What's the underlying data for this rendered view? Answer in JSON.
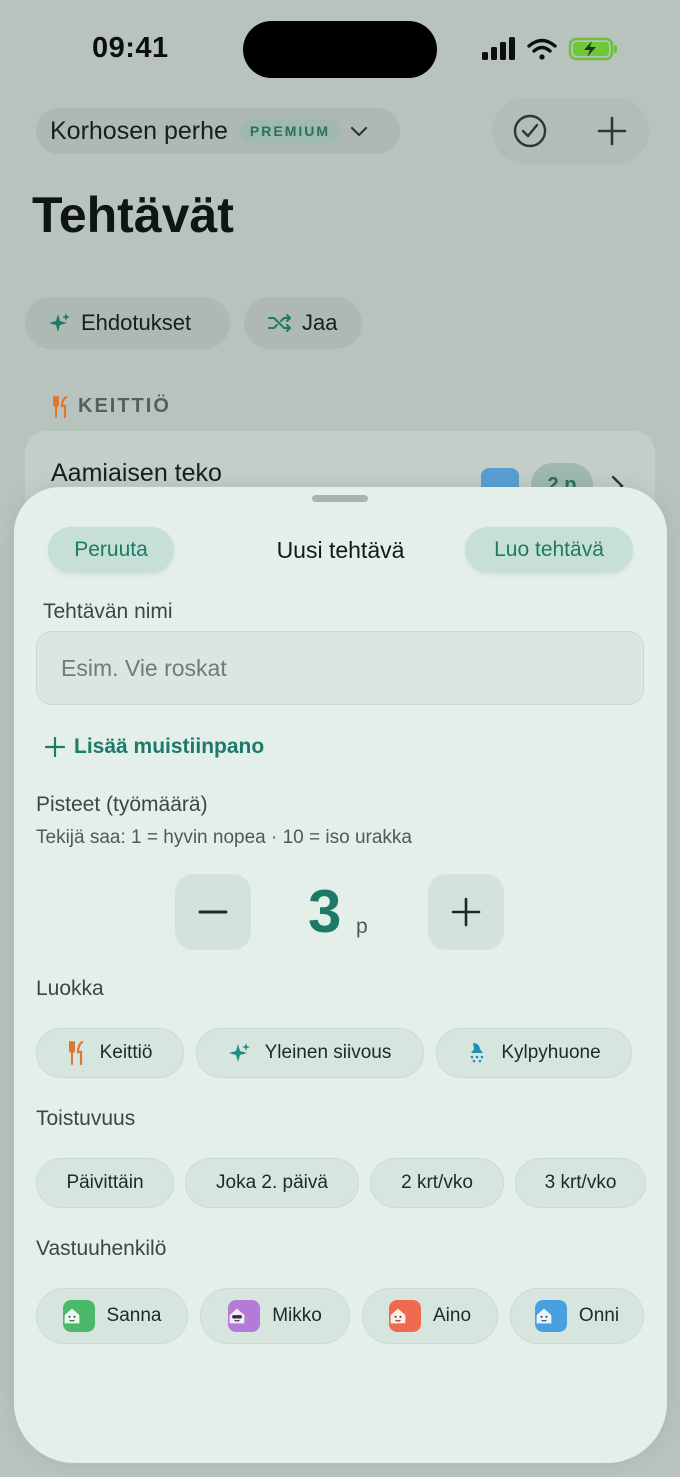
{
  "status": {
    "time": "09:41"
  },
  "header": {
    "family_name": "Korhosen perhe",
    "badge": "PREMIUM"
  },
  "page": {
    "title": "Tehtävät"
  },
  "chips": {
    "suggestions": "Ehdotukset",
    "share": "Jaa"
  },
  "section": {
    "kitchen": "KEITTIÖ"
  },
  "task": {
    "name": "Aamiaisen teko",
    "points": "2 p"
  },
  "sheet": {
    "cancel": "Peruuta",
    "title": "Uusi tehtävä",
    "create": "Luo tehtävä",
    "name_label": "Tehtävän nimi",
    "name_placeholder": "Esim. Vie roskat",
    "add_note": "Lisää muistiinpano",
    "points_label": "Pisteet (työmäärä)",
    "points_hint": "Tekijä saa: 1 = hyvin nopea · 10 = iso urakka",
    "points_value": "3",
    "points_unit": "p",
    "category_label": "Luokka",
    "categories": [
      "Keittiö",
      "Yleinen siivous",
      "Kylpyhuone"
    ],
    "frequency_label": "Toistuvuus",
    "frequencies": [
      "Päivittäin",
      "Joka 2. päivä",
      "2 krt/vko",
      "3 krt/vko"
    ],
    "assignee_label": "Vastuuhenkilö",
    "assignees": [
      {
        "name": "Sanna",
        "color": "#4cb86a"
      },
      {
        "name": "Mikko",
        "color": "#b47ad8"
      },
      {
        "name": "Aino",
        "color": "#ee6a4e"
      },
      {
        "name": "Onni",
        "color": "#4a9fe0"
      }
    ]
  },
  "colors": {
    "accent": "#1e7a68",
    "sheet_bg": "#e4efe9"
  }
}
